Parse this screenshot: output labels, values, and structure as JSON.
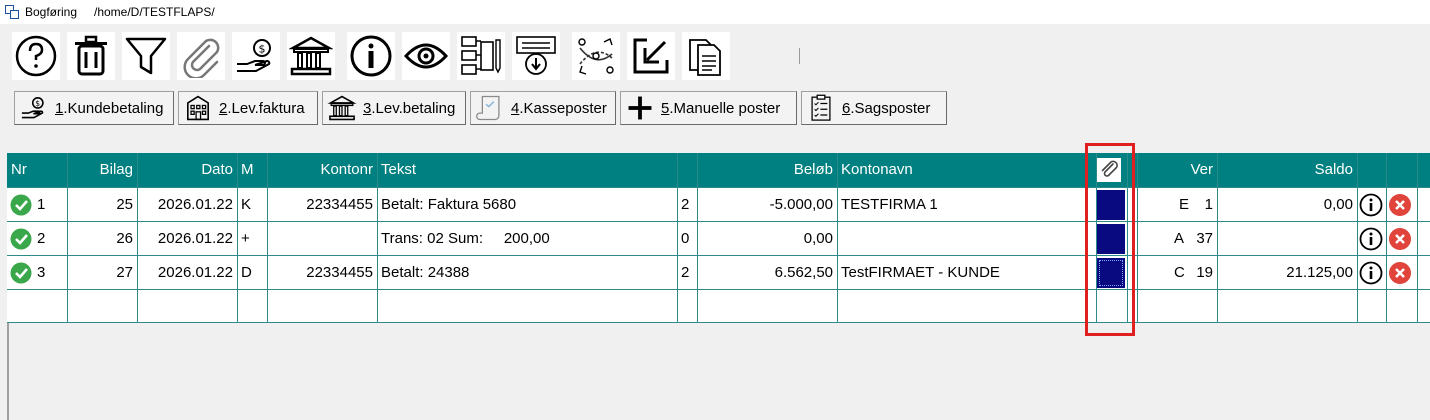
{
  "window": {
    "app_title": "Bogføring",
    "path": "/home/D/TESTFLAPS/"
  },
  "toolbar": {
    "icons": [
      "help-icon",
      "trash-icon",
      "filter-icon",
      "paperclip-icon",
      "payment-hand-icon",
      "bank-icon",
      "info-icon",
      "eye-icon",
      "document-flow-icon",
      "bank-import-icon",
      "network-icon",
      "export-icon",
      "copy-documents-icon"
    ]
  },
  "tabs": [
    {
      "num": "1",
      "label": ".Kundebetaling",
      "icon": "payment-hand-icon"
    },
    {
      "num": "2",
      "label": ".Lev.faktura",
      "icon": "building-icon"
    },
    {
      "num": "3",
      "label": ".Lev.betaling",
      "icon": "bank-icon"
    },
    {
      "num": "4",
      "label": ".Kasseposter",
      "icon": "scroll-icon"
    },
    {
      "num": "5",
      "label": ".Manuelle poster",
      "icon": "plus-icon"
    },
    {
      "num": "6",
      "label": ".Sagsposter",
      "icon": "checklist-icon"
    }
  ],
  "grid": {
    "headers": {
      "nr": "Nr",
      "bilag": "Bilag",
      "dato": "Dato",
      "m": "M",
      "kontonr": "Kontonr",
      "tekst": "Tekst",
      "moms": "",
      "belob": "Beløb",
      "kontonavn": "Kontonavn",
      "ver": "Ver",
      "saldo": "Saldo"
    },
    "rows": [
      {
        "nr": "1",
        "bilag": "25",
        "dato": "2026.01.22",
        "m": "K",
        "kontonr": "22334455",
        "tekst": "Betalt: Faktura 5680",
        "moms": "2",
        "belob": "-5.000,00",
        "kontonavn": "TESTFIRMA 1",
        "ver_letter": "E",
        "ver_num": "1",
        "saldo": "0,00"
      },
      {
        "nr": "2",
        "bilag": "26",
        "dato": "2026.01.22",
        "m": "+",
        "kontonr": "",
        "tekst": "Trans: 02 Sum:     200,00",
        "moms": "0",
        "belob": "0,00",
        "kontonavn": "",
        "ver_letter": "A",
        "ver_num": "37",
        "saldo": ""
      },
      {
        "nr": "3",
        "bilag": "27",
        "dato": "2026.01.22",
        "m": "D",
        "kontonr": "22334455",
        "tekst": "Betalt: 24388",
        "moms": "2",
        "belob": "6.562,50",
        "kontonavn": "TestFIRMAET - KUNDE",
        "ver_letter": "C",
        "ver_num": "19",
        "saldo": "21.125,00"
      }
    ]
  },
  "colors": {
    "header_bg": "#008080",
    "attachment_cell": "#0a0a80",
    "highlight": "#e02020",
    "check": "#3aa84a",
    "delete": "#e0443a"
  }
}
